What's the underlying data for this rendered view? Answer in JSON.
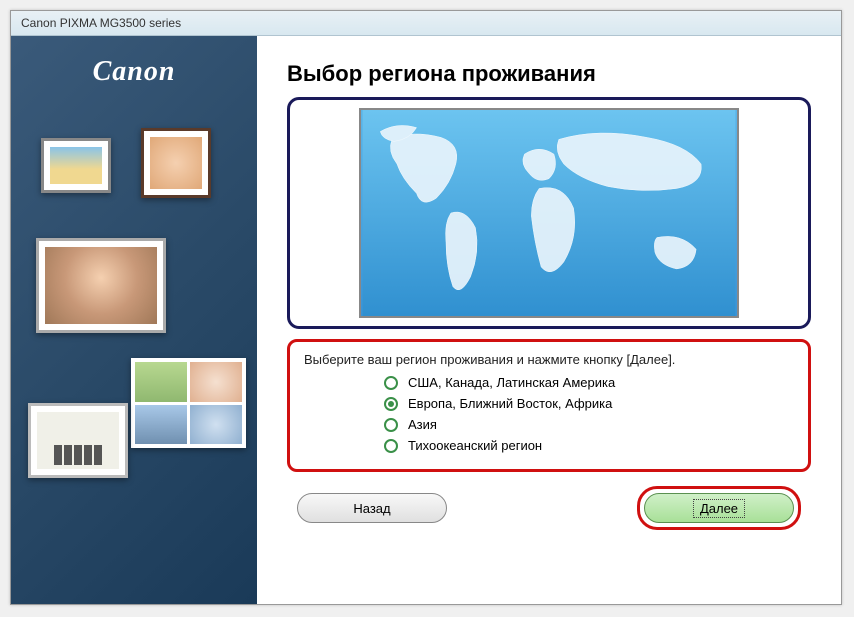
{
  "titlebar": "Canon PIXMA MG3500 series",
  "logo": "Canon",
  "heading": "Выбор региона проживания",
  "instruction": "Выберите ваш регион проживания и нажмите кнопку [Далее].",
  "options": {
    "o1": "США, Канада, Латинская Америка",
    "o2": "Европа, Ближний Восток, Африка",
    "o3": "Азия",
    "o4": "Тихоокеанский регион"
  },
  "selected": "o2",
  "buttons": {
    "back": "Назад",
    "next": "Далее"
  }
}
